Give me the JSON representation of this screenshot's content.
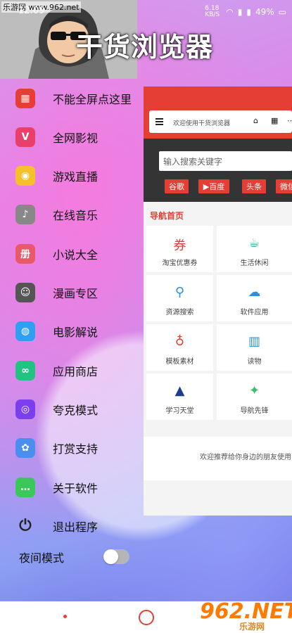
{
  "watermark_top": "乐游网 www.962.net",
  "status": {
    "time": "12:09",
    "network_speed": "6.18 KB/S",
    "battery": "49%"
  },
  "hero_title": "干货浏览器",
  "menu": [
    {
      "label": "不能全屏点这里",
      "icon": "grid-icon",
      "color": "#e53e35"
    },
    {
      "label": "全网影视",
      "icon": "video-icon",
      "color": "#e8406b"
    },
    {
      "label": "游戏直播",
      "icon": "eye-icon",
      "color": "#f5c12a"
    },
    {
      "label": "在线音乐",
      "icon": "music-icon",
      "color": "#888888"
    },
    {
      "label": "小说大全",
      "icon": "book-icon",
      "color": "#e85a6a"
    },
    {
      "label": "漫画专区",
      "icon": "comic-icon",
      "color": "#555555"
    },
    {
      "label": "电影解说",
      "icon": "robot-icon",
      "color": "#2f9ff0"
    },
    {
      "label": "应用商店",
      "icon": "store-icon",
      "color": "#22c283"
    },
    {
      "label": "夸克模式",
      "icon": "quark-icon",
      "color": "#7b3ff0"
    },
    {
      "label": "打赏支持",
      "icon": "anime-icon",
      "color": "#4a8ef0"
    },
    {
      "label": "关于软件",
      "icon": "chat-icon",
      "color": "#3bc85a"
    },
    {
      "label": "退出程序",
      "icon": "power-icon",
      "color": "#222222"
    }
  ],
  "night_mode": {
    "label": "夜间模式",
    "on": false
  },
  "browser": {
    "url_title": "欢迎使用干货浏览器",
    "search_placeholder": "输入搜索关键字",
    "chips": [
      "谷歌",
      "▶百度",
      "头条",
      "微信"
    ],
    "section_title": "导航首页",
    "nav_cells": [
      {
        "label": "淘宝优惠券",
        "icon": "coupon-icon",
        "color": "#e53e35"
      },
      {
        "label": "生活休闲",
        "icon": "cup-icon",
        "color": "#2bb59a"
      },
      {
        "label": "资源搜索",
        "icon": "search-icon",
        "color": "#2f8fd8"
      },
      {
        "label": "软件应用",
        "icon": "cloud-icon",
        "color": "#2f8fd8"
      },
      {
        "label": "模板素材",
        "icon": "bulb-icon",
        "color": "#e53e35"
      },
      {
        "label": "读物",
        "icon": "book-open-icon",
        "color": "#2f8fd8"
      },
      {
        "label": "学习天堂",
        "icon": "cap-icon",
        "color": "#1f3b8a"
      },
      {
        "label": "导航先锋",
        "icon": "nav-icon",
        "color": "#3bbf6a"
      }
    ],
    "footer_text": "欢迎推荐给你身边的朋友使用"
  },
  "watermark_bottom": {
    "big": "962.NET",
    "sub": "乐游网"
  }
}
